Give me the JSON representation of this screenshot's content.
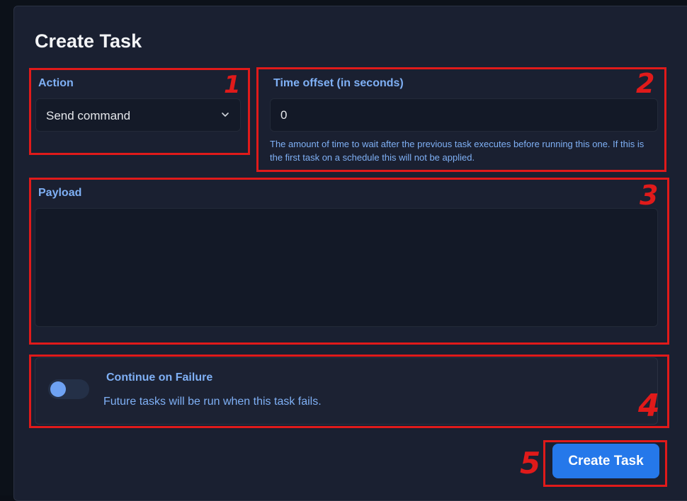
{
  "modal": {
    "title": "Create Task"
  },
  "action": {
    "label": "Action",
    "selected": "Send command"
  },
  "time_offset": {
    "label": "Time offset (in seconds)",
    "value": "0",
    "help": "The amount of time to wait after the previous task executes before running this one. If this is the first task on a schedule this will not be applied."
  },
  "payload": {
    "label": "Payload",
    "value": ""
  },
  "continue_on_failure": {
    "title": "Continue on Failure",
    "description": "Future tasks will be run when this task fails.",
    "enabled": false
  },
  "submit": {
    "label": "Create Task"
  },
  "annotations": [
    "1",
    "2",
    "3",
    "4",
    "5"
  ],
  "colors": {
    "annotation": "#e01a1a",
    "accent": "#2578ea",
    "label": "#7fb0f5",
    "modal_bg": "#1a2031"
  },
  "icons": [
    "chevron-down-icon"
  ]
}
